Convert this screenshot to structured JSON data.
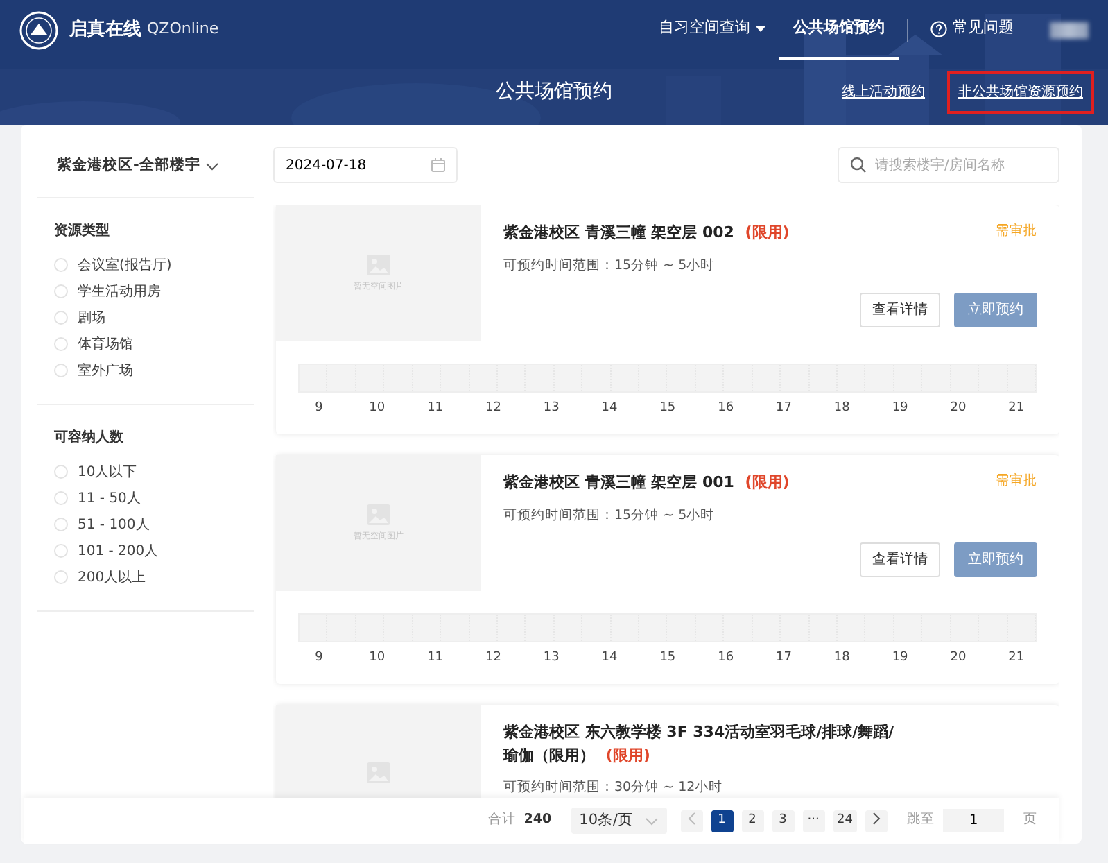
{
  "brand": {
    "name": "启真在线",
    "sub": "QZOnline"
  },
  "nav": [
    {
      "label": "自习空间查询",
      "kind": "dropdown",
      "selected": false
    },
    {
      "label": "公共场馆预约",
      "kind": "link",
      "selected": true
    },
    {
      "label": "常见问题",
      "kind": "help",
      "selected": false
    }
  ],
  "hero": {
    "title": "公共场馆预约",
    "links": [
      {
        "label": "线上活动预约",
        "highlighted": false
      },
      {
        "label": "非公共场馆资源预约",
        "highlighted": true
      }
    ]
  },
  "sidebar": {
    "campus": "紫金港校区-全部楼宇",
    "groups": [
      {
        "title": "资源类型",
        "options": [
          {
            "label": "会议室(报告厅)",
            "checked": false
          },
          {
            "label": "学生活动用房",
            "checked": false
          },
          {
            "label": "剧场",
            "checked": false
          },
          {
            "label": "体育场馆",
            "checked": false
          },
          {
            "label": "室外广场",
            "checked": false
          }
        ]
      },
      {
        "title": "可容纳人数",
        "options": [
          {
            "label": "10人以下",
            "checked": false
          },
          {
            "label": "11 - 50人",
            "checked": false
          },
          {
            "label": "51 - 100人",
            "checked": false
          },
          {
            "label": "101 - 200人",
            "checked": false
          },
          {
            "label": "200人以上",
            "checked": false
          }
        ]
      }
    ]
  },
  "date": {
    "value": "2024-07-18"
  },
  "search": {
    "placeholder": "请搜索楼宇/房间名称"
  },
  "venues": [
    {
      "image_text": "暂无空间图片",
      "name": "紫金港校区 青溪三幢 架空层 002",
      "tag": "(限用)",
      "approval": "需审批",
      "range": "可预约时间范围：15分钟 ~ 5小时",
      "details": "查看详情",
      "book": "立即预约",
      "hours": [
        "9",
        "10",
        "11",
        "12",
        "13",
        "14",
        "15",
        "16",
        "17",
        "18",
        "19",
        "20",
        "21"
      ]
    },
    {
      "image_text": "暂无空间图片",
      "name": "紫金港校区 青溪三幢 架空层 001",
      "tag": "(限用)",
      "approval": "需审批",
      "range": "可预约时间范围：15分钟 ~ 5小时",
      "details": "查看详情",
      "book": "立即预约",
      "hours": [
        "9",
        "10",
        "11",
        "12",
        "13",
        "14",
        "15",
        "16",
        "17",
        "18",
        "19",
        "20",
        "21"
      ]
    },
    {
      "name": "紫金港校区 东六教学楼 3F 334活动室羽毛球/排球/舞蹈/瑜伽（限用）",
      "tag": "(限用)",
      "range": "可预约时间范围：30分钟 ~ 12小时"
    }
  ],
  "pagination": {
    "total_label": "合计",
    "total": "240",
    "page_size": "10条/页",
    "pages": [
      {
        "label": "1",
        "selected": true
      },
      {
        "label": "2",
        "selected": false
      },
      {
        "label": "3",
        "selected": false
      },
      {
        "label": "···",
        "selected": false
      },
      {
        "label": "24",
        "selected": false
      }
    ],
    "goto_label": "跳至",
    "goto_value": "1",
    "page_label": "页"
  }
}
